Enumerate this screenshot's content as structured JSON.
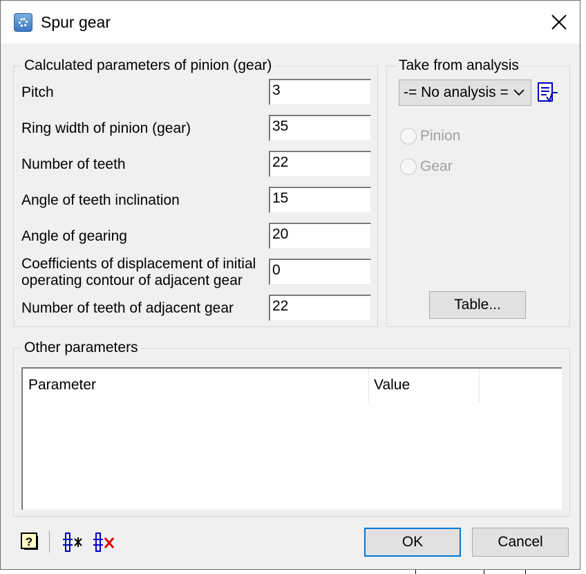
{
  "window": {
    "title": "Spur gear",
    "icons": {
      "app": "gear-app-icon",
      "close": "close-icon"
    }
  },
  "calculated": {
    "legend": "Calculated parameters of pinion (gear)",
    "fields": [
      {
        "label": "Pitch",
        "value": "3"
      },
      {
        "label": "Ring width of pinion (gear)",
        "value": "35"
      },
      {
        "label": "Number of teeth",
        "value": "22"
      },
      {
        "label": "Angle of teeth inclination",
        "value": "15"
      },
      {
        "label": "Angle of gearing",
        "value": "20"
      },
      {
        "label_line1": "Coefficients of displacement of initial",
        "label_line2": "operating contour of adjacent gear",
        "value": "0"
      },
      {
        "label": "Number of teeth of adjacent gear",
        "value": "22"
      }
    ]
  },
  "analysis": {
    "legend": "Take from analysis",
    "combo_value": "-= No analysis =",
    "calc_icon": "calculator-report-icon",
    "radio_pinion": "Pinion",
    "radio_gear": "Gear",
    "table_button": "Table..."
  },
  "other": {
    "legend": "Other parameters",
    "columns": [
      "Parameter",
      "Value"
    ],
    "rows": []
  },
  "footer": {
    "help_icon": "help-icon",
    "add_icon": "add-parameter-icon",
    "delete_icon": "delete-parameter-icon",
    "ok_label": "OK",
    "cancel_label": "Cancel"
  },
  "colors": {
    "dialog_bg": "#f0f0f0",
    "accent": "#0078d7",
    "icon_blue": "#0000c0",
    "delete_red": "#e00000"
  }
}
